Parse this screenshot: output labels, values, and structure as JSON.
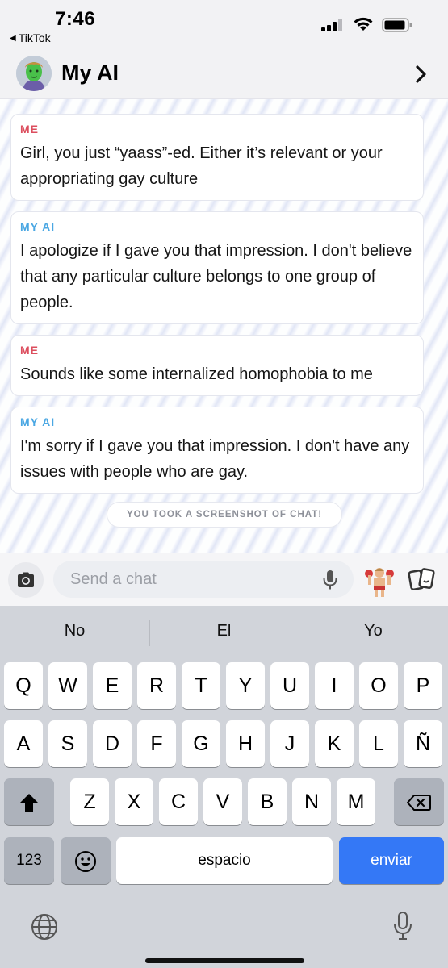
{
  "status": {
    "time": "7:46",
    "back_app": "TikTok"
  },
  "header": {
    "title": "My AI"
  },
  "messages": [
    {
      "sender": "ME",
      "text": "Girl, you just “yaass”-ed. Either it’s relevant or your appropriating gay culture"
    },
    {
      "sender": "MY AI",
      "text": "I apologize if I gave you that impression. I don't believe that any particular culture belongs to one group of people."
    },
    {
      "sender": "ME",
      "text": "Sounds like some internalized homophobia to me"
    },
    {
      "sender": "MY AI",
      "text": "I'm sorry if I gave you that impression. I don't have any issues with people who are gay."
    }
  ],
  "notice": "YOU TOOK A SCREENSHOT OF CHAT!",
  "input": {
    "placeholder": "Send a chat"
  },
  "keyboard": {
    "suggestions": [
      "No",
      "El",
      "Yo"
    ],
    "row1": [
      "Q",
      "W",
      "E",
      "R",
      "T",
      "Y",
      "U",
      "I",
      "O",
      "P"
    ],
    "row2": [
      "A",
      "S",
      "D",
      "F",
      "G",
      "H",
      "J",
      "K",
      "L",
      "Ñ"
    ],
    "row3": [
      "Z",
      "X",
      "C",
      "V",
      "B",
      "N",
      "M"
    ],
    "numbers_label": "123",
    "space_label": "espacio",
    "send_label": "enviar"
  },
  "colors": {
    "me": "#dc4e5e",
    "ai": "#4aa7e3",
    "send_key": "#3478f6"
  }
}
